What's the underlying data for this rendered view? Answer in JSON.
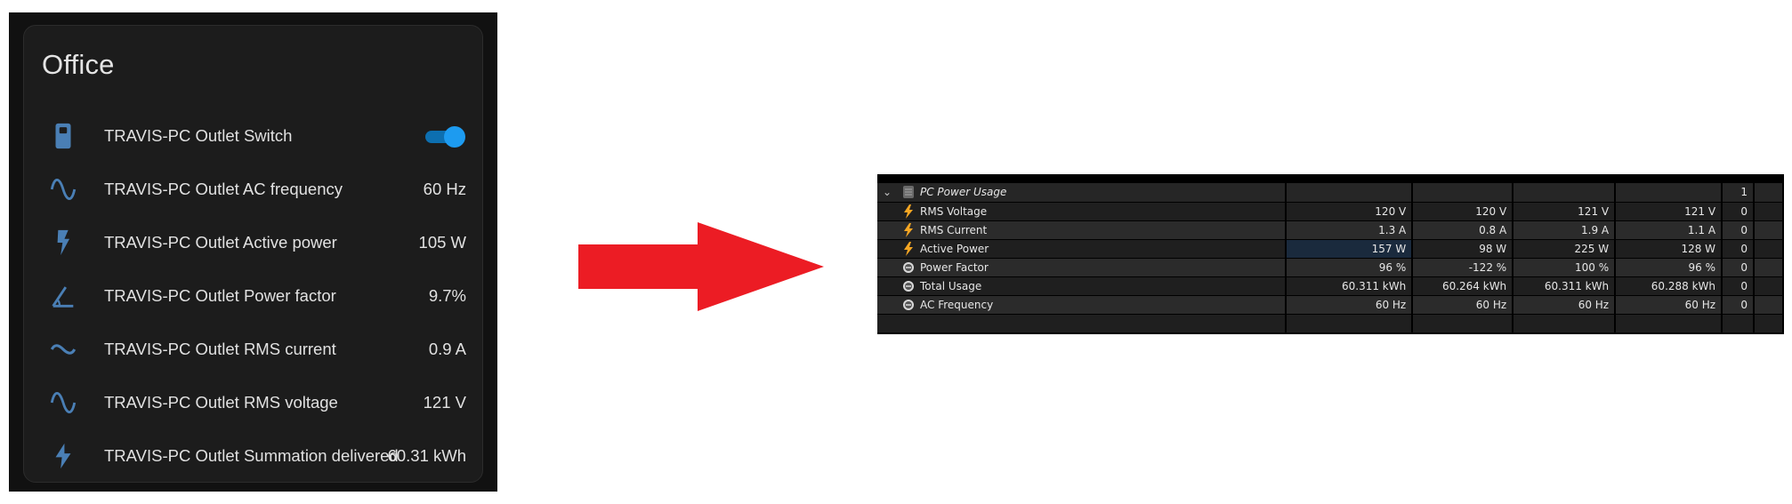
{
  "left_card": {
    "title": "Office",
    "toggle_on": true,
    "rows": [
      {
        "icon": "outlet-switch-icon",
        "label": "TRAVIS-PC Outlet Switch",
        "value": ""
      },
      {
        "icon": "sine-wave-icon",
        "label": "TRAVIS-PC Outlet AC frequency",
        "value": "60 Hz"
      },
      {
        "icon": "flash-icon",
        "label": "TRAVIS-PC Outlet Active power",
        "value": "105 W"
      },
      {
        "icon": "angle-icon",
        "label": "TRAVIS-PC Outlet Power factor",
        "value": "9.7%"
      },
      {
        "icon": "current-ac-icon",
        "label": "TRAVIS-PC Outlet RMS current",
        "value": "0.9 A"
      },
      {
        "icon": "sine-wave-icon",
        "label": "TRAVIS-PC Outlet RMS voltage",
        "value": "121 V"
      },
      {
        "icon": "lightning-bolt-icon",
        "label": "TRAVIS-PC Outlet Summation delivered",
        "value": "60.31 kWh"
      }
    ]
  },
  "arrow": {
    "color": "#ec1c24"
  },
  "sensor_table": {
    "group": {
      "label": "PC Power Usage",
      "count": "1"
    },
    "rows": [
      {
        "icon": "lightning-bolt-icon",
        "label": "RMS Voltage",
        "current": "120 V",
        "min": "120 V",
        "max": "121 V",
        "avg": "121 V",
        "count": "0"
      },
      {
        "icon": "lightning-bolt-icon",
        "label": "RMS Current",
        "current": "1.3 A",
        "min": "0.8 A",
        "max": "1.9 A",
        "avg": "1.1 A",
        "count": "0"
      },
      {
        "icon": "lightning-bolt-icon",
        "label": "Active Power",
        "current": "157 W",
        "min": "98 W",
        "max": "225 W",
        "avg": "128 W",
        "count": "0"
      },
      {
        "icon": "gauge-icon",
        "label": "Power Factor",
        "current": "96 %",
        "min": "-122 %",
        "max": "100 %",
        "avg": "96 %",
        "count": "0"
      },
      {
        "icon": "gauge-icon",
        "label": "Total Usage",
        "current": "60.311 kWh",
        "min": "60.264 kWh",
        "max": "60.311 kWh",
        "avg": "60.288 kWh",
        "count": "0"
      },
      {
        "icon": "gauge-icon",
        "label": "AC Frequency",
        "current": "60 Hz",
        "min": "60 Hz",
        "max": "60 Hz",
        "avg": "60 Hz",
        "count": "0"
      }
    ]
  },
  "colors": {
    "accent_blue": "#1d9bf0",
    "icon_blue": "#4a7fb5",
    "bolt_orange": "#f5a623",
    "card_bg": "#1c1c1c"
  }
}
